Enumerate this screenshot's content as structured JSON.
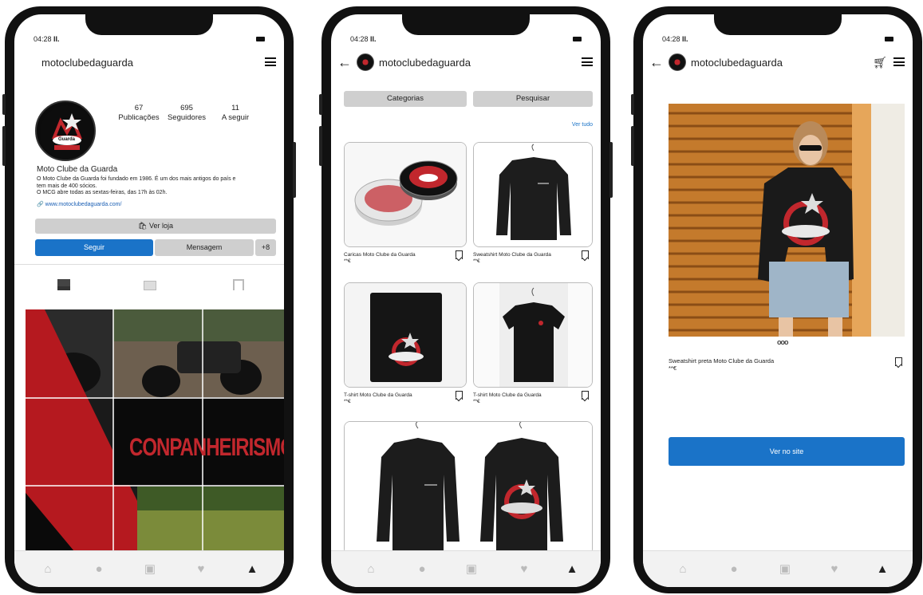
{
  "status": {
    "time": "04:28",
    "signal": "II."
  },
  "username": "motoclubedaguarda",
  "icons": {
    "menu": "hamburger-icon",
    "back": "arrow-left-icon",
    "cart": "cart-icon",
    "home": "home-icon",
    "search": "search-icon",
    "add": "plus-square-icon",
    "likes": "heart-icon",
    "profile": "person-icon",
    "bookmark": "bookmark-icon"
  },
  "profile": {
    "stats": [
      {
        "value": "67",
        "label": "Publicações"
      },
      {
        "value": "695",
        "label": "Seguidores"
      },
      {
        "value": "11",
        "label": "A seguir"
      }
    ],
    "name": "Moto Clube da Guarda",
    "bio_line1": "O Moto Clube da Guarda foi fundado em 1986. É um dos mais antigos do país e",
    "bio_line2": "tem mais de 400 sócios.",
    "bio_line3": "O MCG abre todas as sextas-feiras, das 17h às 02h.",
    "website": "www.motoclubedaguarda.com/",
    "view_shop": "Ver loja",
    "follow": "Seguir",
    "message": "Mensagem",
    "add_person": "+8",
    "grid_text": "CONPANHEIRISMO",
    "logo_text": "Guarda"
  },
  "shop": {
    "categories": "Categorias",
    "search": "Pesquisar",
    "see_all": "Ver tudo",
    "products": [
      {
        "name": "Caricas Moto Clube da Guarda",
        "price": "**€"
      },
      {
        "name": "Sweatshirt Moto Clube da Guarda",
        "price": "**€"
      },
      {
        "name": "T-shirt Moto Clube da Guarda",
        "price": "**€"
      },
      {
        "name": "T-shirt Moto Clube da Guarda",
        "price": "**€"
      }
    ]
  },
  "product": {
    "name": "Sweatshirt preta Moto Clube da Guarda",
    "price": "**€",
    "carousel_dots": "ooo",
    "cta": "Ver no site"
  },
  "colors": {
    "accent_blue": "#1a73c8",
    "club_red": "#c1272d",
    "button_gray": "#cfcfcf"
  }
}
